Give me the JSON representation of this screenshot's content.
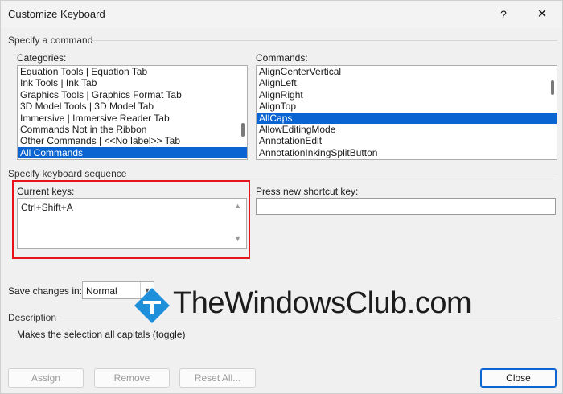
{
  "window": {
    "title": "Customize Keyboard",
    "help_glyph": "?",
    "close_glyph": "✕"
  },
  "command_group": {
    "label": "Specify a command",
    "categories": {
      "label": "Categories:",
      "items": [
        "Equation Tools | Equation Tab",
        "Ink Tools | Ink Tab",
        "Graphics Tools | Graphics Format Tab",
        "3D Model Tools | 3D Model Tab",
        "Immersive | Immersive Reader Tab",
        "Commands Not in the Ribbon",
        "Other Commands | <<No label>> Tab",
        "All Commands"
      ],
      "selected": "All Commands"
    },
    "commands": {
      "label": "Commands:",
      "items": [
        "AlignCenterVertical",
        "AlignLeft",
        "AlignRight",
        "AlignTop",
        "AllCaps",
        "AllowEditingMode",
        "AnnotationEdit",
        "AnnotationInkingSplitButton"
      ],
      "selected": "AllCaps"
    }
  },
  "keyboard_group": {
    "label": "Specify keyboard sequence",
    "current_keys": {
      "label": "Current keys:",
      "items": [
        "Ctrl+Shift+A"
      ]
    },
    "new_shortcut": {
      "label": "Press new shortcut key:",
      "value": ""
    }
  },
  "save_changes": {
    "label": "Save changes in:",
    "value": "Normal"
  },
  "description": {
    "label": "Description",
    "text": "Makes the selection all capitals (toggle)"
  },
  "buttons": {
    "assign": "Assign",
    "remove": "Remove",
    "reset_all": "Reset All...",
    "close": "Close"
  },
  "watermark": {
    "text": "TheWindowsClub.com",
    "logo_color": "#1e8fd9"
  },
  "colors": {
    "selection": "#0a64d2",
    "highlight_border": "#e8141c"
  }
}
